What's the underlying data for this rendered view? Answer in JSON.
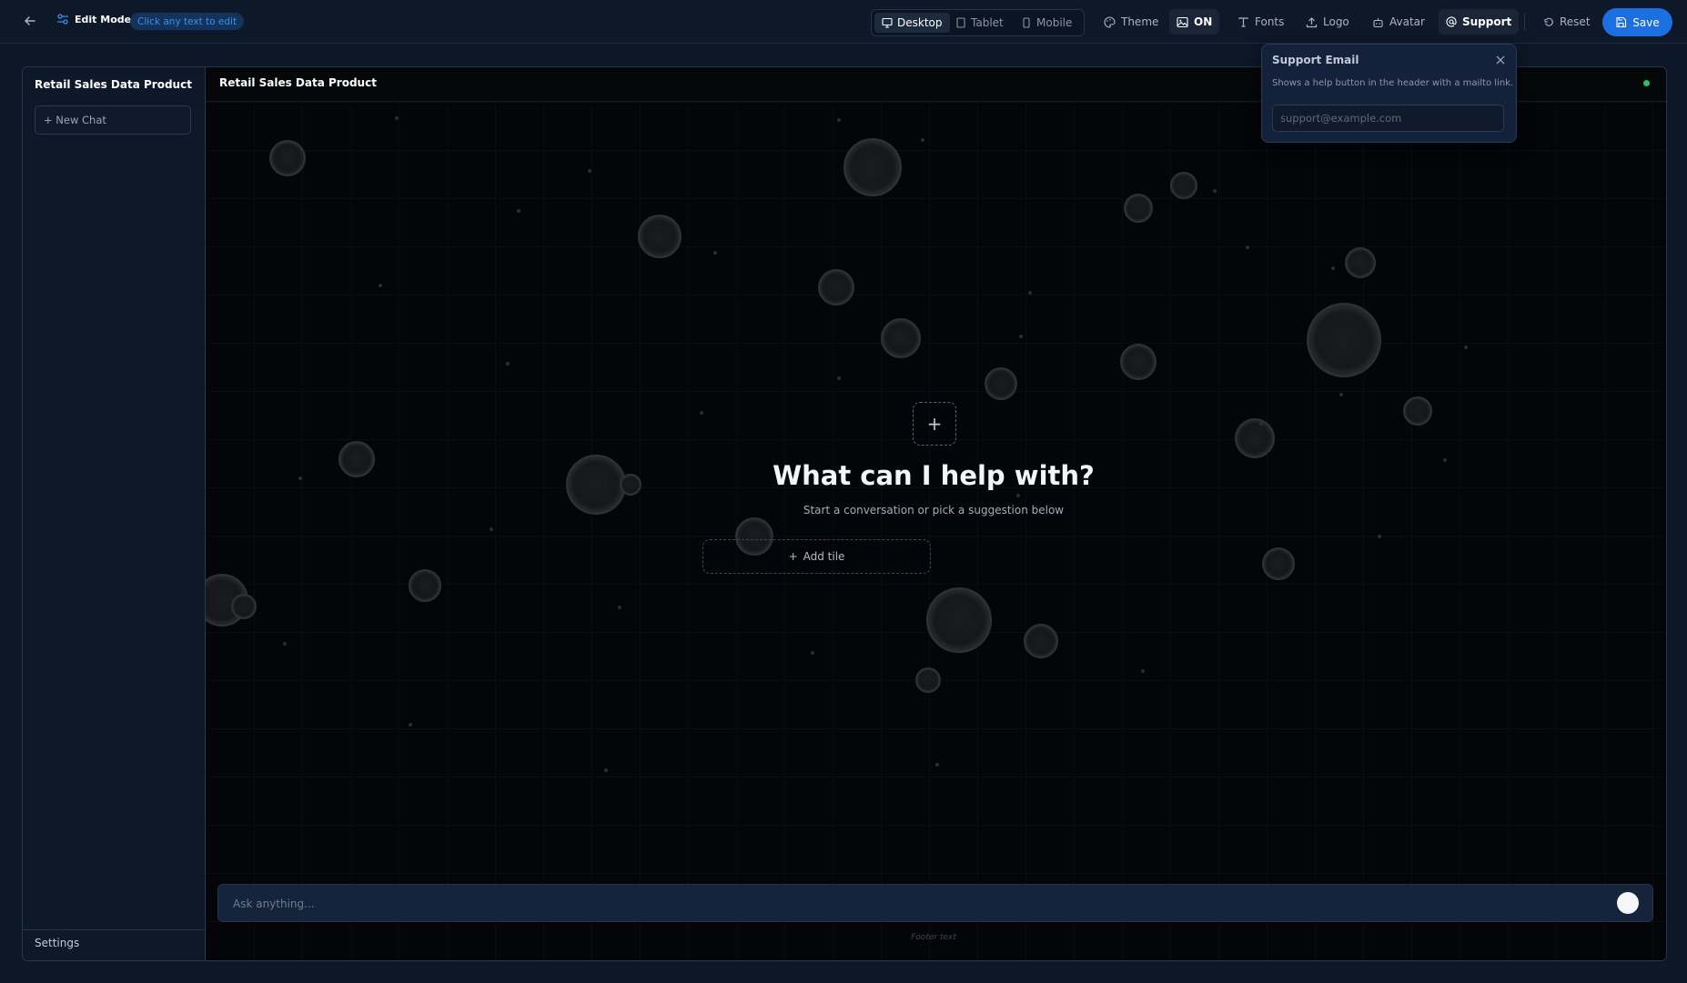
{
  "toolbar": {
    "edit_mode": "Edit Mode",
    "edit_hint": "Click any text to edit",
    "devices": {
      "desktop": "Desktop",
      "tablet": "Tablet",
      "mobile": "Mobile"
    },
    "theme": "Theme",
    "background_state": "ON",
    "fonts": "Fonts",
    "logo": "Logo",
    "avatar": "Avatar",
    "support": "Support",
    "reset": "Reset",
    "save": "Save"
  },
  "sidebar": {
    "title": "Retail Sales Data Product",
    "new_chat": "+ New Chat",
    "settings": "Settings"
  },
  "main": {
    "header_title": "Retail Sales Data Product",
    "hero_title": "What can I help with?",
    "hero_subtitle": "Start a conversation or pick a suggestion below",
    "add_tile": "Add tile",
    "input_placeholder": "Ask anything...",
    "footer_text": "Footer text"
  },
  "support_popover": {
    "title": "Support Email",
    "description": "Shows a help button in the header with a mailto link.",
    "input_placeholder": "support@example.com"
  },
  "colors": {
    "accent": "#1c6fe0",
    "status_online": "#22c55e",
    "app_bg": "#0c1727",
    "canvas_bg": "#040508"
  }
}
